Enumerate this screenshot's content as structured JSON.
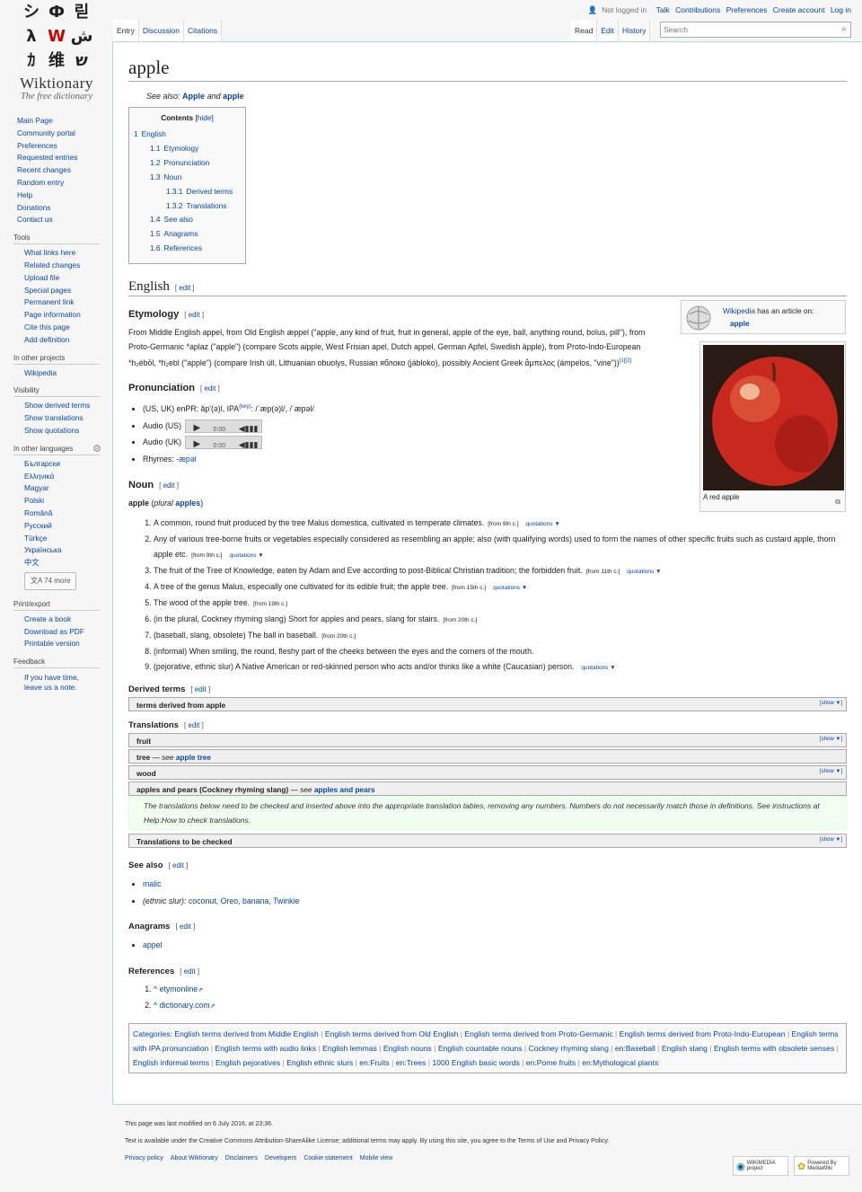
{
  "logo": {
    "glyphs": [
      "シ",
      "Ф",
      "릳",
      "λ",
      "W",
      "ش",
      "ｶ",
      "维",
      "ש"
    ],
    "title": "Wiktionary",
    "tagline": "The free dictionary"
  },
  "nav": {
    "main": [
      "Main Page",
      "Community portal",
      "Preferences",
      "Requested entries",
      "Recent changes",
      "Random entry",
      "Help",
      "Donations",
      "Contact us"
    ],
    "tools_heading": "Tools",
    "tools": [
      "What links here",
      "Related changes",
      "Upload file",
      "Special pages",
      "Permanent link",
      "Page information",
      "Cite this page",
      "Add definition"
    ],
    "other_projects_heading": "In other projects",
    "other_projects": [
      "Wikipedia"
    ],
    "visibility_heading": "Visibility",
    "visibility": [
      "Show derived terms",
      "Show translations",
      "Show quotations"
    ],
    "languages_heading": "In other languages",
    "languages": [
      "Български",
      "Ελληνικά",
      "Magyar",
      "Polski",
      "Română",
      "Русский",
      "Türkçe",
      "Українська",
      "中文"
    ],
    "languages_more": "74 more",
    "print_heading": "Print/export",
    "print": [
      "Create a book",
      "Download as PDF",
      "Printable version"
    ],
    "feedback_heading": "Feedback",
    "feedback": "If you have time, leave us a note."
  },
  "personal": {
    "not_logged": "Not logged in",
    "talk": "Talk",
    "contributions": "Contributions",
    "preferences": "Preferences",
    "create": "Create account",
    "login": "Log in"
  },
  "tabs": {
    "entry": "Entry",
    "discussion": "Discussion",
    "citations": "Citations",
    "read": "Read",
    "edit": "Edit",
    "history": "History"
  },
  "search": {
    "placeholder": "Search"
  },
  "page": {
    "title": "apple",
    "seealso_prefix": "See also:",
    "seealso_1": "Apple",
    "seealso_and": "and",
    "seealso_2": "apple",
    "edit": "edit"
  },
  "toc": {
    "title": "Contents",
    "hide": "hide",
    "items": [
      {
        "num": "1",
        "label": "English",
        "level": 0
      },
      {
        "num": "1.1",
        "label": "Etymology",
        "level": 1
      },
      {
        "num": "1.2",
        "label": "Pronunciation",
        "level": 1
      },
      {
        "num": "1.3",
        "label": "Noun",
        "level": 1
      },
      {
        "num": "1.3.1",
        "label": "Derived terms",
        "level": 2
      },
      {
        "num": "1.3.2",
        "label": "Translations",
        "level": 2
      },
      {
        "num": "1.4",
        "label": "See also",
        "level": 1
      },
      {
        "num": "1.5",
        "label": "Anagrams",
        "level": 1
      },
      {
        "num": "1.6",
        "label": "References",
        "level": 1
      }
    ]
  },
  "sections": {
    "english": "English",
    "etymology": "Etymology",
    "pronunciation": "Pronunciation",
    "noun": "Noun",
    "derived": "Derived terms",
    "translations": "Translations",
    "seealso": "See also",
    "anagrams": "Anagrams",
    "references": "References"
  },
  "wikipedia_box": {
    "text": "Wikipedia",
    "text2": "has an article on:",
    "link": "apple"
  },
  "image_caption": "A red apple",
  "etymology_text": "From Middle English appel, from Old English æppel (\"apple, any kind of fruit, fruit in general, apple of the eye, ball, anything round, bolus, pill\"), from Proto-Germanic *aplaz (\"apple\") (compare Scots aipple, West Frisian apel, Dutch appel, German Apfel, Swedish äpple), from Proto-Indo-European *h₂ébōl, *h₂ebl (\"apple\") (compare Irish úll, Lithuanian obuolys, Russian яблоко (jábloko), possibly Ancient Greek ἄμπελος (ámpelos, \"vine\"))",
  "etymology_refs": "[1][2]",
  "pron": {
    "ipa_pre": "(US, UK) enPR: ăp'(ə)l, IPA",
    "ipa_key": "(key)",
    "ipa_post": ": /ˈæp(ə)l/, /ˈæpəl/",
    "audio_us": "Audio (US)",
    "audio_uk": "Audio (UK)",
    "time": "0:00",
    "rhymes_label": "Rhymes:",
    "rhymes": "-æpəl"
  },
  "headword": {
    "word": "apple",
    "plural_label": "plural",
    "plural": "apples"
  },
  "defs": [
    {
      "text": "A common, round fruit produced by the tree Malus domestica, cultivated in temperate climates.",
      "tag": "[from 9th c.]",
      "quot": "quotations ▼"
    },
    {
      "text": "Any of various tree-borne fruits or vegetables especially considered as resembling an apple; also (with qualifying words) used to form the names of other specific fruits such as custard apple, thorn apple etc.",
      "tag": "[from 9th c.]",
      "quot": "quotations ▼"
    },
    {
      "text": "The fruit of the Tree of Knowledge, eaten by Adam and Eve according to post-Biblical Christian tradition; the forbidden fruit.",
      "tag": "[from 11th c.]",
      "quot": "quotations ▼"
    },
    {
      "text": "A tree of the genus Malus, especially one cultivated for its edible fruit; the apple tree.",
      "tag": "[from 15th c.]",
      "quot": "quotations ▼"
    },
    {
      "text": "The wood of the apple tree.",
      "tag": "[from 19th c.]",
      "quot": ""
    },
    {
      "text": "(in the plural, Cockney rhyming slang) Short for apples and pears, slang for stairs.",
      "tag": "[from 20th c.]",
      "quot": ""
    },
    {
      "text": "(baseball, slang, obsolete) The ball in baseball.",
      "tag": "[from 20th c.]",
      "quot": ""
    },
    {
      "text": "(informal) When smiling, the round, fleshy part of the cheeks between the eyes and the corners of the mouth.",
      "tag": "",
      "quot": ""
    },
    {
      "text": "(pejorative, ethnic slur) A Native American or red-skinned person who acts and/or thinks like a white (Caucasian) person.",
      "tag": "",
      "quot": "quotations ▼"
    }
  ],
  "derived_box": "terms derived from apple",
  "show": "[show ▼]",
  "trans_boxes": [
    {
      "label": "fruit",
      "see": "",
      "link": ""
    },
    {
      "label": "tree",
      "see": " — see ",
      "link": "apple tree"
    },
    {
      "label": "wood",
      "see": "",
      "link": ""
    },
    {
      "label": "apples and pears (Cockney rhyming slang)",
      "see": " — see ",
      "link": "apples and pears"
    }
  ],
  "check_note": "The translations below need to be checked and inserted above into the appropriate translation tables, removing any numbers. Numbers do not necessarily match those in definitions. See instructions at Help:How to check translations.",
  "check_box": "Translations to be checked",
  "seealso_items": [
    "malic"
  ],
  "seealso_slur_label": "(ethnic slur):",
  "seealso_slur": "coconut, Oreo, banana, Twinkie",
  "anagrams": [
    "appel"
  ],
  "references": [
    "^ etymonline",
    "^ dictionary.com"
  ],
  "categories_label": "Categories:",
  "categories": [
    "English terms derived from Middle English",
    "English terms derived from Old English",
    "English terms derived from Proto-Germanic",
    "English terms derived from Proto-Indo-European",
    "English terms with IPA pronunciation",
    "English terms with audio links",
    "English lemmas",
    "English nouns",
    "English countable nouns",
    "Cockney rhyming slang",
    "en:Baseball",
    "English slang",
    "English terms with obsolete senses",
    "English informal terms",
    "English pejoratives",
    "English ethnic slurs",
    "en:Fruits",
    "en:Trees",
    "1000 English basic words",
    "en:Pome fruits",
    "en:Mythological plants"
  ],
  "footer": {
    "modified": "This page was last modified on 6 July 2016, at 23:36.",
    "license": "Text is available under the Creative Commons Attribution-ShareAlike License; additional terms may apply. By using this site, you agree to the Terms of Use and Privacy Policy.",
    "links": [
      "Privacy policy",
      "About Wiktionary",
      "Disclaimers",
      "Developers",
      "Cookie statement",
      "Mobile view"
    ],
    "wikimedia": "WIKIMEDIA project",
    "mediawiki": "Powered By MediaWiki"
  },
  "colors": {
    "link": "#0645ad",
    "redlink": "#ba0000",
    "apple_red": "#c8281e"
  }
}
